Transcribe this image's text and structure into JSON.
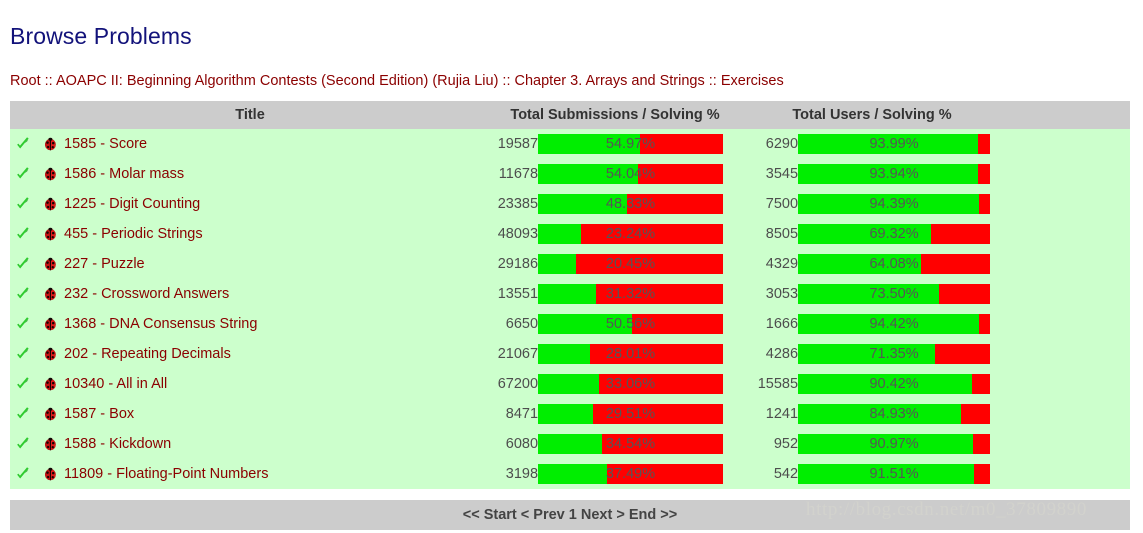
{
  "page_title": "Browse Problems",
  "breadcrumb": "Root :: AOAPC II: Beginning Algorithm Contests (Second Edition) (Rujia Liu) :: Chapter 3. Arrays and Strings :: Exercises",
  "colors": {
    "title": "#12127a",
    "breadcrumb": "#8b0000",
    "header_bg": "#cccccc",
    "row_bg": "#ccffcc",
    "bar_green": "#00ee00",
    "bar_red": "#ff0000",
    "link": "#8b0000"
  },
  "table": {
    "headers": {
      "title": "Title",
      "submissions": "Total Submissions / Solving %",
      "users": "Total Users / Solving %"
    },
    "icons": {
      "check": "check-icon",
      "bug": "bug-icon"
    },
    "rows": [
      {
        "title": "1585 - Score",
        "submissions": "19587",
        "sub_pct": "54.97%",
        "sub_value": 54.97,
        "users": "6290",
        "usr_pct": "93.99%",
        "usr_value": 93.99
      },
      {
        "title": "1586 - Molar mass",
        "submissions": "11678",
        "sub_pct": "54.04%",
        "sub_value": 54.04,
        "users": "3545",
        "usr_pct": "93.94%",
        "usr_value": 93.94
      },
      {
        "title": "1225 - Digit Counting",
        "submissions": "23385",
        "sub_pct": "48.33%",
        "sub_value": 48.33,
        "users": "7500",
        "usr_pct": "94.39%",
        "usr_value": 94.39
      },
      {
        "title": "455 - Periodic Strings",
        "submissions": "48093",
        "sub_pct": "23.24%",
        "sub_value": 23.24,
        "users": "8505",
        "usr_pct": "69.32%",
        "usr_value": 69.32
      },
      {
        "title": "227 - Puzzle",
        "submissions": "29186",
        "sub_pct": "20.45%",
        "sub_value": 20.45,
        "users": "4329",
        "usr_pct": "64.08%",
        "usr_value": 64.08
      },
      {
        "title": "232 - Crossword Answers",
        "submissions": "13551",
        "sub_pct": "31.32%",
        "sub_value": 31.32,
        "users": "3053",
        "usr_pct": "73.50%",
        "usr_value": 73.5
      },
      {
        "title": "1368 - DNA Consensus String",
        "submissions": "6650",
        "sub_pct": "50.56%",
        "sub_value": 50.56,
        "users": "1666",
        "usr_pct": "94.42%",
        "usr_value": 94.42
      },
      {
        "title": "202 - Repeating Decimals",
        "submissions": "21067",
        "sub_pct": "28.01%",
        "sub_value": 28.01,
        "users": "4286",
        "usr_pct": "71.35%",
        "usr_value": 71.35
      },
      {
        "title": "10340 - All in All",
        "submissions": "67200",
        "sub_pct": "33.06%",
        "sub_value": 33.06,
        "users": "15585",
        "usr_pct": "90.42%",
        "usr_value": 90.42
      },
      {
        "title": "1587 - Box",
        "submissions": "8471",
        "sub_pct": "29.51%",
        "sub_value": 29.51,
        "users": "1241",
        "usr_pct": "84.93%",
        "usr_value": 84.93
      },
      {
        "title": "1588 - Kickdown",
        "submissions": "6080",
        "sub_pct": "34.54%",
        "sub_value": 34.54,
        "users": "952",
        "usr_pct": "90.97%",
        "usr_value": 90.97
      },
      {
        "title": "11809 - Floating-Point Numbers",
        "submissions": "3198",
        "sub_pct": "37.49%",
        "sub_value": 37.49,
        "users": "542",
        "usr_pct": "91.51%",
        "usr_value": 91.51
      }
    ]
  },
  "pager": {
    "start": "<< Start",
    "prev": "< Prev",
    "current": "1",
    "next": "Next >",
    "end": "End >>"
  },
  "watermark": "http://blog.csdn.net/m0_37809890"
}
